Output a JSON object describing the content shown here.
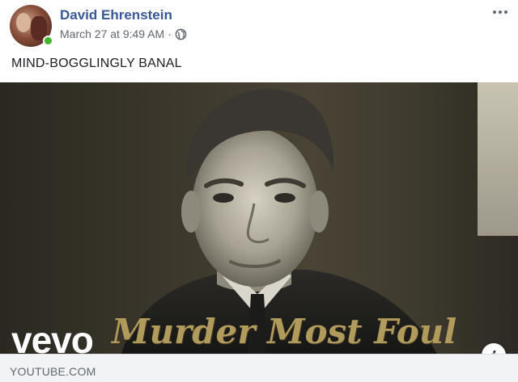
{
  "post": {
    "author": "David Ehrenstein",
    "timestamp": "March 27 at 9:49 AM",
    "separator": "·",
    "privacy_icon": "globe-icon",
    "text": "MIND-BOGGLINGLY BANAL"
  },
  "media": {
    "brand": "vevo",
    "title": "Murder Most Foul",
    "info_label": "i"
  },
  "link": {
    "domain": "YOUTUBE.COM"
  },
  "colors": {
    "author": "#385898",
    "meta": "#616770",
    "online": "#42b72a",
    "footer_bg": "#f2f3f5"
  }
}
